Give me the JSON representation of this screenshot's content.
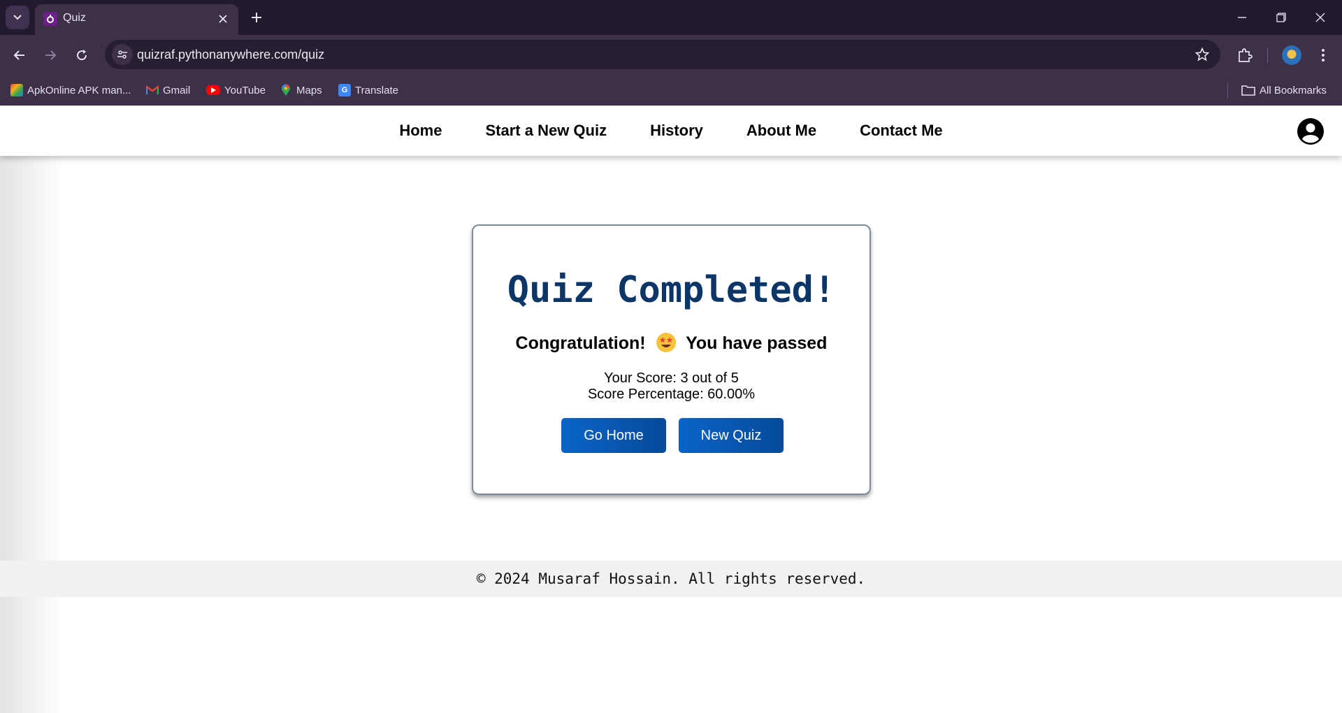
{
  "browser": {
    "tab": {
      "title": "Quiz",
      "favicon": "quiz-favicon-icon"
    },
    "url": "quizraf.pythonanywhere.com/quiz",
    "bookmarks": [
      {
        "label": "ApkOnline APK man...",
        "icon": "apkonline-icon"
      },
      {
        "label": "Gmail",
        "icon": "gmail-icon"
      },
      {
        "label": "YouTube",
        "icon": "youtube-icon"
      },
      {
        "label": "Maps",
        "icon": "maps-icon"
      },
      {
        "label": "Translate",
        "icon": "translate-icon"
      }
    ],
    "all_bookmarks": "All Bookmarks"
  },
  "site_nav": {
    "links": [
      "Home",
      "Start a New Quiz",
      "History",
      "About Me",
      "Contact Me"
    ],
    "account_icon": "account-circle-icon"
  },
  "result": {
    "title": "Quiz Completed!",
    "message_before": "Congratulation!",
    "emoji": "star-struck-emoji",
    "message_after": "You have passed",
    "score_text": "Your Score: 3 out of 5",
    "percentage_text": "Score Percentage: 60.00%",
    "buttons": {
      "home": "Go Home",
      "new_quiz": "New Quiz"
    }
  },
  "footer": {
    "text": "© 2024 Musaraf Hossain. All rights reserved."
  },
  "colors": {
    "title": "#0c3668",
    "button": "#0a64c8",
    "chrome": "#3d3149"
  }
}
